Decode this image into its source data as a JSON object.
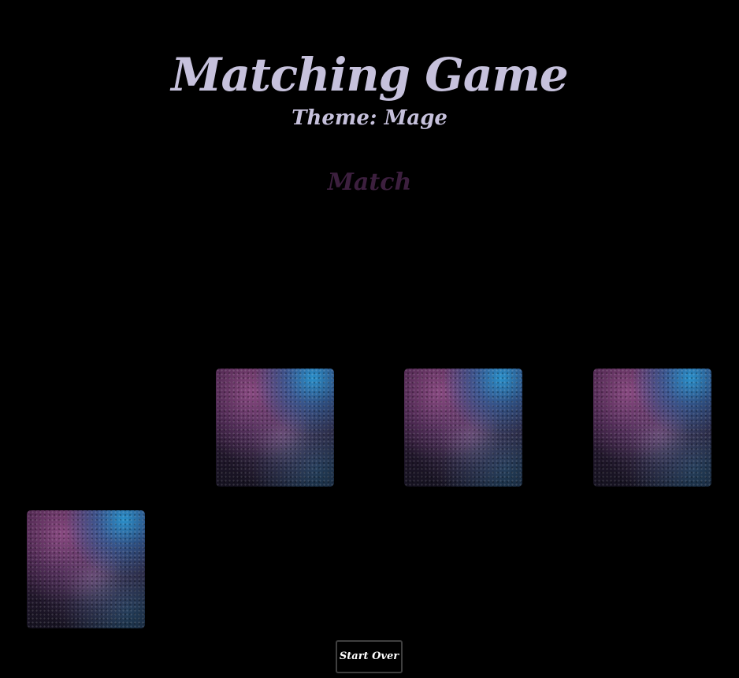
{
  "header": {
    "title": "Matching Game",
    "theme": "Theme: Mage",
    "status": "Match"
  },
  "board": {
    "cards": [
      {
        "state": "face-down"
      },
      {
        "state": "face-down"
      },
      {
        "state": "face-down"
      },
      {
        "state": "face-down"
      }
    ]
  },
  "controls": {
    "start_over_label": "Start Over"
  },
  "colors": {
    "background": "#000000",
    "title": "#c6c1dc",
    "status": "#3c1f3e",
    "button_text": "#ffffff",
    "button_border": "#3f3f3f"
  }
}
